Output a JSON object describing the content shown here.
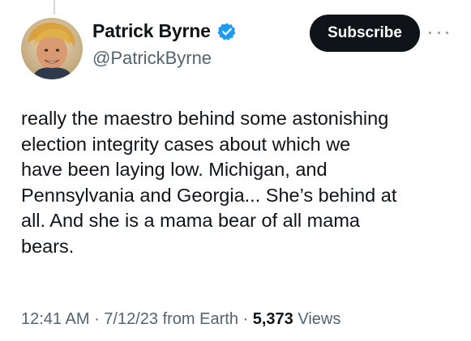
{
  "author": {
    "display_name": "Patrick Byrne",
    "handle": "@PatrickByrne",
    "verified": true,
    "verified_color": "#1d9bf0",
    "avatar_icon": "profile-photo"
  },
  "actions": {
    "subscribe_label": "Subscribe",
    "more_icon": "more-horizontal-icon"
  },
  "tweet": {
    "text": "really the maestro behind some astonishing\nelection integrity cases about which we\nhave been laying low. Michigan, and\nPennsylvania and Georgia... She’s behind at\nall. And she is a mama bear of all mama\nbears."
  },
  "meta": {
    "time": "12:41 AM",
    "separator1": " · ",
    "date": "7/12/23",
    "source": " from Earth",
    "separator2": " · ",
    "views_count": "5,373",
    "views_label": " Views"
  },
  "colors": {
    "text_primary": "#0f1419",
    "text_secondary": "#536471",
    "button_bg": "#0f1419",
    "button_text": "#ffffff"
  }
}
